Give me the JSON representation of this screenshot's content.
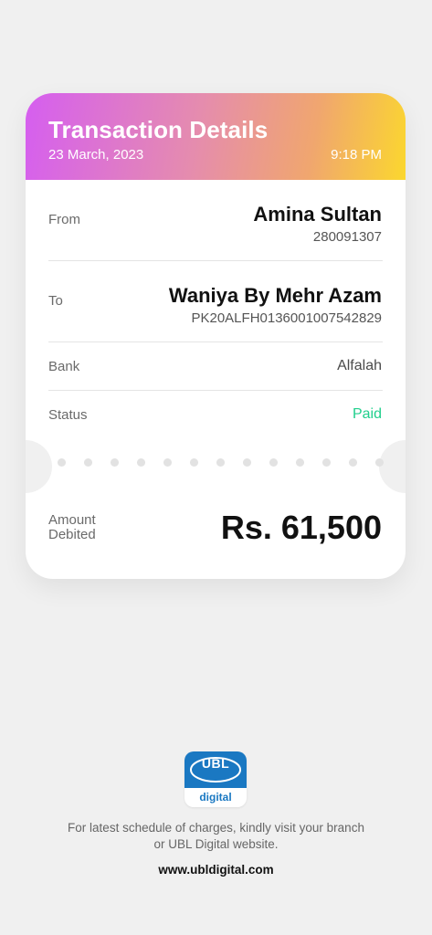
{
  "header": {
    "title": "Transaction Details",
    "date": "23 March, 2023",
    "time": "9:18 PM"
  },
  "from": {
    "label": "From",
    "name": "Amina Sultan",
    "account": "280091307"
  },
  "to": {
    "label": "To",
    "name": "Waniya By Mehr Azam",
    "account": "PK20ALFH0136001007542829"
  },
  "bank": {
    "label": "Bank",
    "value": "Alfalah"
  },
  "status": {
    "label": "Status",
    "value": "Paid",
    "color": "#1fcf8c"
  },
  "amount": {
    "label_line1": "Amount",
    "label_line2": "Debited",
    "value": "Rs. 61,500"
  },
  "footer": {
    "logo_text": "UBL",
    "logo_subtext": "digital",
    "line1": "For latest schedule of charges, kindly visit your branch",
    "line2": "or UBL Digital website.",
    "url": "www.ubldigital.com"
  },
  "colors": {
    "brand_blue": "#1a78c2",
    "gradient": [
      "#d55ef0",
      "#e58cae",
      "#f0a66f",
      "#fbd72e"
    ]
  }
}
